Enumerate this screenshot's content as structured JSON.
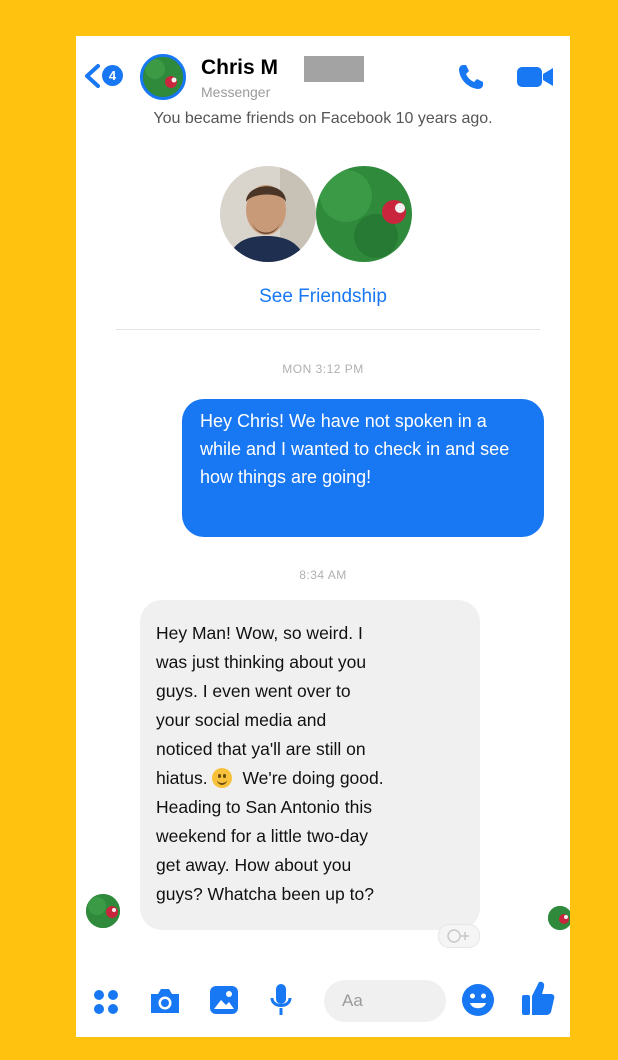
{
  "header": {
    "back_badge": "4",
    "contact_name": "Chris M",
    "subtitle": "Messenger"
  },
  "intro": {
    "friends_note": "You became friends on Facebook 10 years ago.",
    "see_friendship": "See Friendship"
  },
  "messages": [
    {
      "timestamp": "MON 3:12 PM",
      "direction": "outgoing",
      "text": "Hey Chris! We have not spoken in a while and I wanted to check in and see how things are going!"
    },
    {
      "timestamp": "8:34 AM",
      "direction": "incoming",
      "lines": [
        "Hey Man! Wow, so weird.  I",
        "was just thinking about you",
        "guys.  I even went over to",
        "your social media and",
        "noticed that ya'll are still on",
        "hiatus.",
        "We're doing good.",
        "Heading to San Antonio this",
        "weekend for a little two-day",
        "get away.  How about you",
        "guys?  Whatcha been up to?"
      ]
    }
  ],
  "composer": {
    "placeholder": "Aa"
  },
  "colors": {
    "accent": "#1877f2",
    "frame": "#ffc20e",
    "incoming_bubble": "#f0f0f0"
  },
  "icons": {
    "back": "chevron-left-icon",
    "call": "phone-icon",
    "video": "video-camera-icon",
    "apps": "four-dots-icon",
    "camera": "camera-icon",
    "gallery": "image-icon",
    "mic": "microphone-icon",
    "emoji": "smiley-icon",
    "like": "thumbs-up-icon"
  }
}
